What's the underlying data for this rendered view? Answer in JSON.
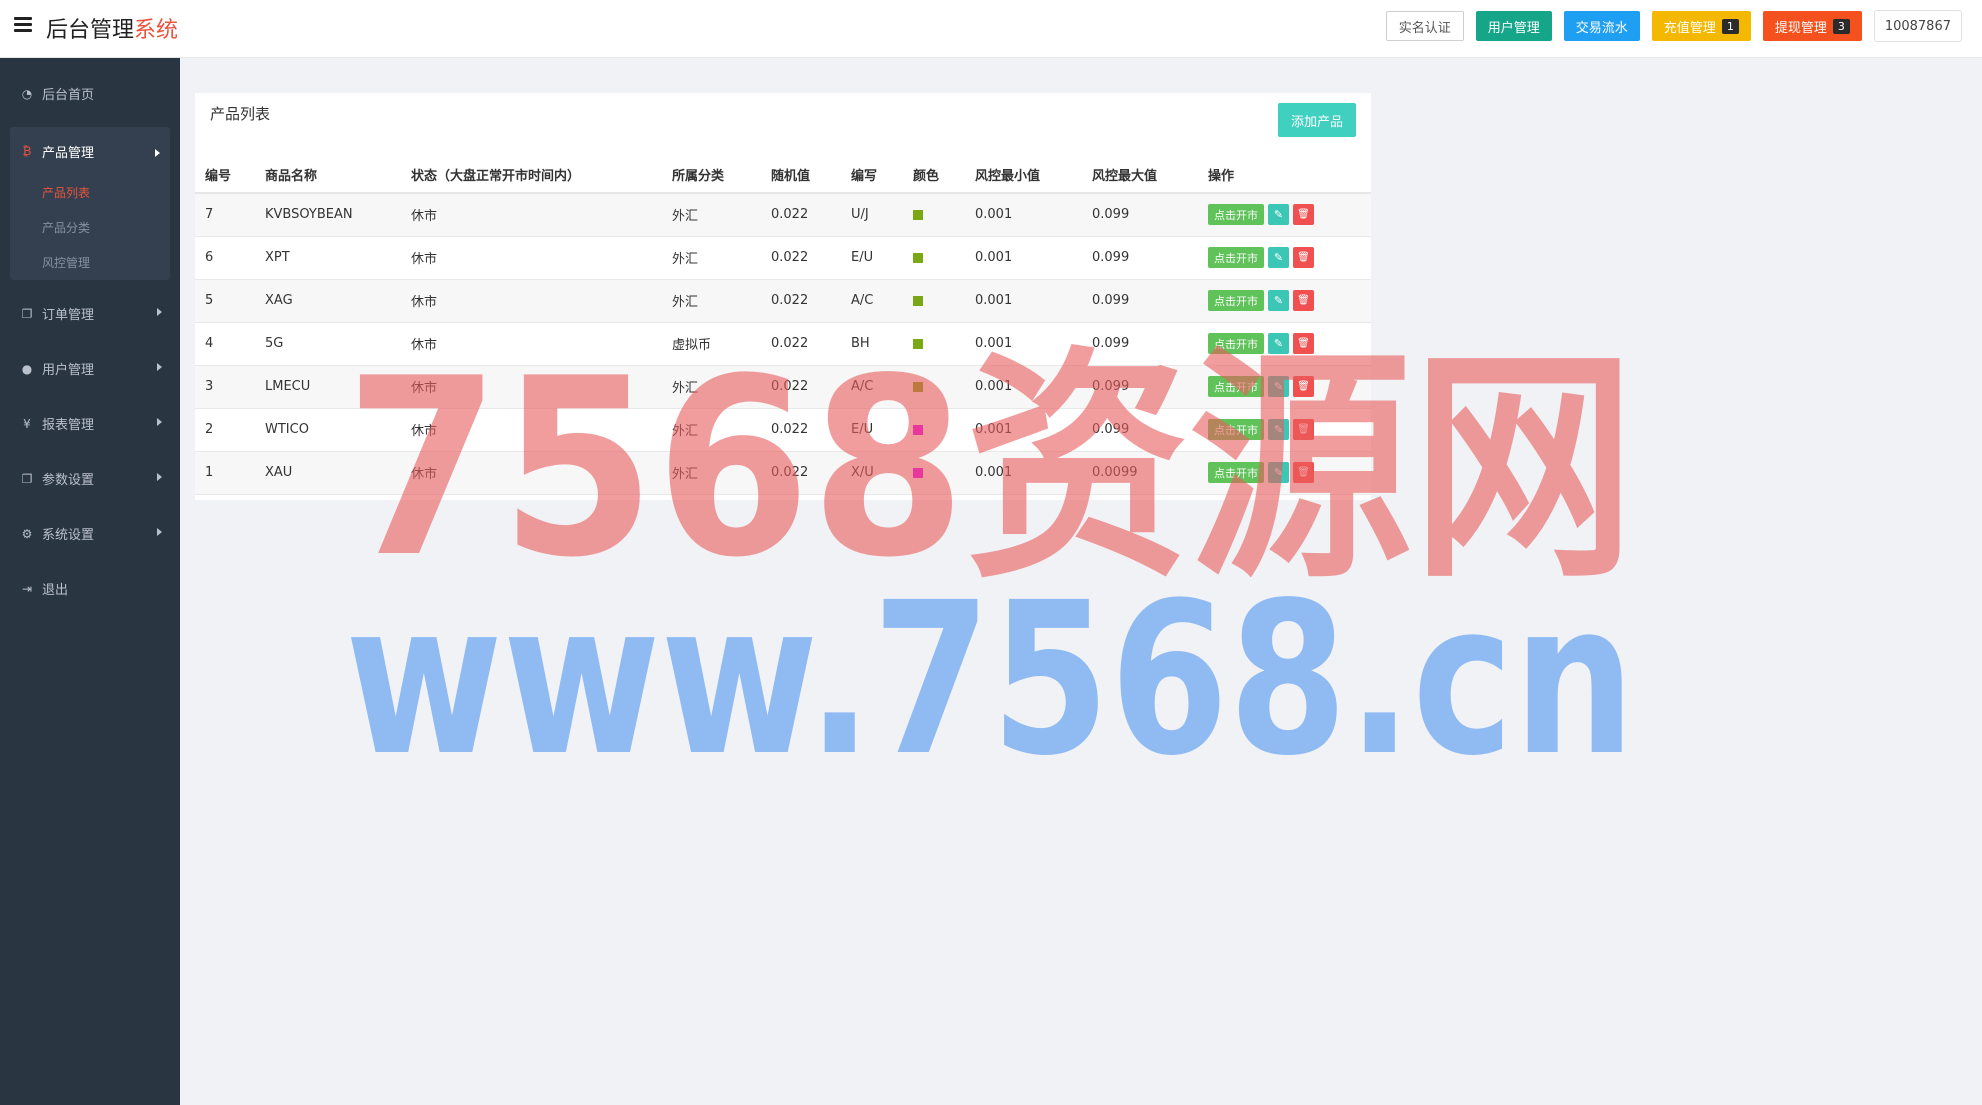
{
  "app": {
    "title_main": "后台管理",
    "title_accent": "系统"
  },
  "topbar": {
    "buttons": [
      {
        "label": "实名认证"
      },
      {
        "label": "用户管理"
      },
      {
        "label": "交易流水"
      },
      {
        "label": "充值管理",
        "badge": "1"
      },
      {
        "label": "提现管理",
        "badge": "3"
      }
    ],
    "user": "10087867"
  },
  "sidebar": {
    "items": [
      {
        "label": "后台首页",
        "icon": "dashboard-icon"
      },
      {
        "label": "产品管理",
        "icon": "bitcoin-icon",
        "expanded": true,
        "children": [
          {
            "label": "产品列表",
            "active": true
          },
          {
            "label": "产品分类"
          },
          {
            "label": "风控管理"
          }
        ]
      },
      {
        "label": "订单管理",
        "icon": "copy-icon"
      },
      {
        "label": "用户管理",
        "icon": "user-icon"
      },
      {
        "label": "报表管理",
        "icon": "yen-icon"
      },
      {
        "label": "参数设置",
        "icon": "copy-icon"
      },
      {
        "label": "系统设置",
        "icon": "gears-icon"
      },
      {
        "label": "退出",
        "icon": "sign-out-icon"
      }
    ]
  },
  "panel": {
    "title": "产品列表",
    "add_button": "添加产品",
    "columns": [
      "编号",
      "商品名称",
      "状态（大盘正常开市时间内）",
      "所属分类",
      "随机值",
      "编写",
      "颜色",
      "风控最小值",
      "风控最大值",
      "操作"
    ],
    "rows": [
      {
        "id": "7",
        "name": "KVBSOYBEAN",
        "status": "休市",
        "category": "外汇",
        "random": "0.022",
        "code": "U/J",
        "color": "#7aa815",
        "min": "0.001",
        "max": "0.099"
      },
      {
        "id": "6",
        "name": "XPT",
        "status": "休市",
        "category": "外汇",
        "random": "0.022",
        "code": "E/U",
        "color": "#7aa815",
        "min": "0.001",
        "max": "0.099"
      },
      {
        "id": "5",
        "name": "XAG",
        "status": "休市",
        "category": "外汇",
        "random": "0.022",
        "code": "A/C",
        "color": "#7aa815",
        "min": "0.001",
        "max": "0.099"
      },
      {
        "id": "4",
        "name": "5G",
        "status": "休市",
        "category": "虚拟币",
        "random": "0.022",
        "code": "BH",
        "color": "#7aa815",
        "min": "0.001",
        "max": "0.099"
      },
      {
        "id": "3",
        "name": "LMECU",
        "status": "休市",
        "category": "外汇",
        "random": "0.022",
        "code": "A/C",
        "color": "#7aa815",
        "min": "0.001",
        "max": "0.099"
      },
      {
        "id": "2",
        "name": "WTICO",
        "status": "休市",
        "category": "外汇",
        "random": "0.022",
        "code": "E/U",
        "color": "#e600ff",
        "min": "0.001",
        "max": "0.099"
      },
      {
        "id": "1",
        "name": "XAU",
        "status": "休市",
        "category": "外汇",
        "random": "0.022",
        "code": "X/U",
        "color": "#e600ff",
        "min": "0.001",
        "max": "0.0099"
      }
    ],
    "action_labels": {
      "open": "点击开市"
    }
  },
  "watermark": {
    "line1": "7568资源网",
    "line2": "www.7568.cn"
  }
}
